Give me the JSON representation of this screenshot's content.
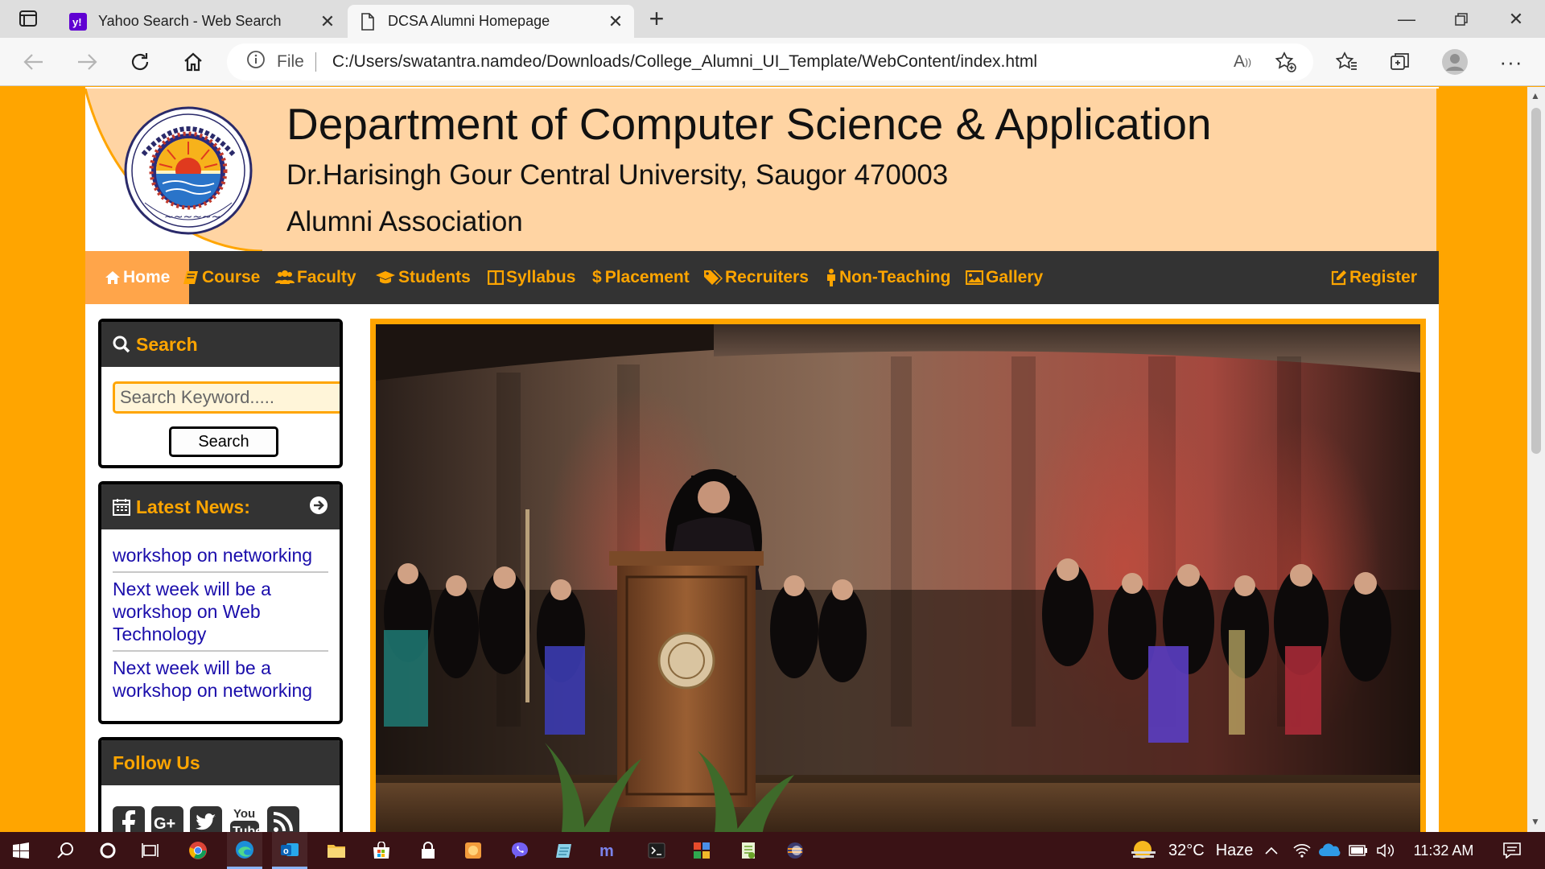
{
  "browser": {
    "tabs": [
      {
        "title": "Yahoo Search - Web Search",
        "favicon": "yahoo-icon",
        "active": false
      },
      {
        "title": "DCSA Alumni Homepage",
        "favicon": "document-icon",
        "active": true
      }
    ],
    "address": {
      "scheme_label": "File",
      "url": "C:/Users/swatantra.namdeo/Downloads/College_Alumni_UI_Template/WebContent/index.html"
    },
    "read_aloud_glyph": "A",
    "colors": {
      "tabbar": "#dedede",
      "toolbar": "#f7f7f7"
    }
  },
  "site": {
    "header": {
      "title": "Department of Computer Science & Application",
      "university": "Dr.Harisingh Gour Central University, Saugor 470003",
      "association": "Alumni Association",
      "background_color": "#ffd4a3"
    },
    "menu": {
      "items": [
        {
          "label": "Home",
          "icon": "home-icon",
          "active": true
        },
        {
          "label": "Course",
          "icon": "book-icon"
        },
        {
          "label": "Faculty",
          "icon": "users-icon"
        },
        {
          "label": "Students",
          "icon": "graduation-cap-icon"
        },
        {
          "label": "Syllabus",
          "icon": "columns-icon"
        },
        {
          "label": "Placement",
          "icon": "dollar-icon"
        },
        {
          "label": "Recruiters",
          "icon": "tags-icon"
        },
        {
          "label": "Non-Teaching",
          "icon": "male-icon"
        },
        {
          "label": "Gallery",
          "icon": "image-icon"
        },
        {
          "label": "Register",
          "icon": "edit-icon"
        }
      ]
    },
    "search": {
      "title": "Search",
      "placeholder": "Search Keyword.....",
      "button": "Search"
    },
    "news": {
      "title": "Latest News:",
      "items": [
        "workshop on networking",
        "Next week will be a workshop on Web Technology",
        "Next week will be a workshop on networking"
      ]
    },
    "follow": {
      "title": "Follow Us",
      "icons": [
        "facebook-icon",
        "google-plus-icon",
        "twitter-icon",
        "youtube-icon",
        "rss-icon"
      ]
    },
    "colors": {
      "accent": "#ffa500",
      "menu_bg": "#333333",
      "active_menu": "#ffa54a",
      "link": "#1a0dab"
    }
  },
  "taskbar": {
    "weather": {
      "temp": "32°C",
      "condition": "Haze"
    },
    "clock": "11:32 AM",
    "color": "#3a1215"
  }
}
